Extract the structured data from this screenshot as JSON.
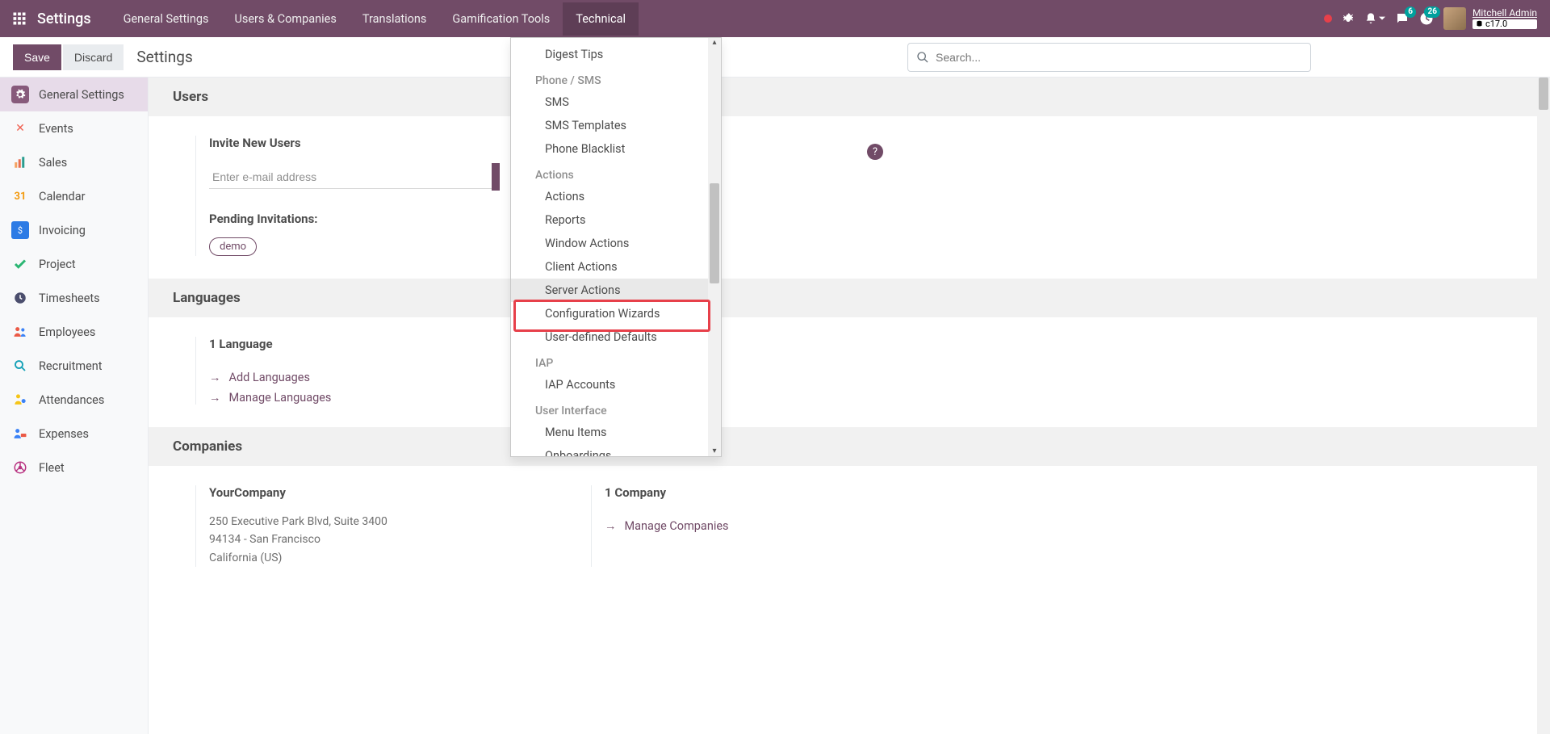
{
  "brand": "Settings",
  "topmenu": {
    "general": "General Settings",
    "users": "Users & Companies",
    "translations": "Translations",
    "gamification": "Gamification Tools",
    "technical": "Technical"
  },
  "nav_right": {
    "msg_badge": "6",
    "activity_badge": "26",
    "user_name": "Mitchell Admin",
    "db_label": "c17.0"
  },
  "controlbar": {
    "save": "Save",
    "discard": "Discard",
    "breadcrumb": "Settings",
    "search_placeholder": "Search..."
  },
  "sidebar": [
    {
      "key": "general",
      "label": "General Settings",
      "color": "#71639e"
    },
    {
      "key": "events",
      "label": "Events",
      "color": "#f06050"
    },
    {
      "key": "sales",
      "label": "Sales",
      "color": "#f4a261"
    },
    {
      "key": "calendar",
      "label": "Calendar",
      "color": "#f39c12"
    },
    {
      "key": "invoicing",
      "label": "Invoicing",
      "color": "#2c7be5"
    },
    {
      "key": "project",
      "label": "Project",
      "color": "#2bb673"
    },
    {
      "key": "timesheets",
      "label": "Timesheets",
      "color": "#4b4e6d"
    },
    {
      "key": "employees",
      "label": "Employees",
      "color": "#eb5a46"
    },
    {
      "key": "recruitment",
      "label": "Recruitment",
      "color": "#17a2b8"
    },
    {
      "key": "attendances",
      "label": "Attendances",
      "color": "#f5c518"
    },
    {
      "key": "expenses",
      "label": "Expenses",
      "color": "#3b82f6"
    },
    {
      "key": "fleet",
      "label": "Fleet",
      "color": "#b83280"
    }
  ],
  "users_section": {
    "header": "Users",
    "invite_label": "Invite New Users",
    "email_placeholder": "Enter e-mail address",
    "pending_label": "Pending Invitations:",
    "pending_items": [
      "demo"
    ]
  },
  "languages_section": {
    "header": "Languages",
    "count_label": "1 Language",
    "add_link": "Add Languages",
    "manage_link": "Manage Languages"
  },
  "companies_section": {
    "header": "Companies",
    "company_name": "YourCompany",
    "addr1": "250 Executive Park Blvd, Suite 3400",
    "addr2": "94134 - San Francisco",
    "addr3": "California (US)",
    "count_label": "1 Company",
    "manage_link": "Manage Companies"
  },
  "dropdown": {
    "digest_tips": "Digest Tips",
    "phone_sms_header": "Phone / SMS",
    "sms": "SMS",
    "sms_templates": "SMS Templates",
    "phone_blacklist": "Phone Blacklist",
    "actions_header": "Actions",
    "actions": "Actions",
    "reports": "Reports",
    "window_actions": "Window Actions",
    "client_actions": "Client Actions",
    "server_actions": "Server Actions",
    "config_wizards": "Configuration Wizards",
    "user_defaults": "User-defined Defaults",
    "iap_header": "IAP",
    "iap_accounts": "IAP Accounts",
    "ui_header": "User Interface",
    "menu_items": "Menu Items",
    "onboardings": "Onboardings"
  }
}
